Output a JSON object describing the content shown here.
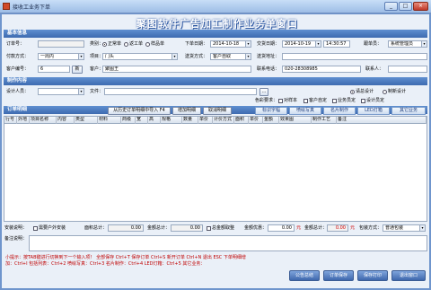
{
  "window": {
    "title": "接收工业务下单",
    "min": "_",
    "max": "□",
    "close": "×"
  },
  "heading": "聚图软件广告加工制作业务单窗口",
  "sections": {
    "basic": "基本信息",
    "design": "制作内容",
    "detail": "订单明细"
  },
  "basic": {
    "order_no_label": "订单号：",
    "category_label": "类别：",
    "category_options": [
      "正常单",
      "返工单",
      "样品单"
    ],
    "order_date_label": "下单日期：",
    "order_date": "2014-10-18",
    "delivery_date_label": "交货日期：",
    "delivery_date": "2014-10-19",
    "delivery_time": "14:30:57",
    "follower_label": "跟单员：",
    "follower": "系统管理员",
    "payment_label": "付款方式：",
    "payment": "一周内",
    "project_label": "项目：",
    "project": "门头",
    "ship_method_label": "送货方式：",
    "ship_method": "客户自取",
    "ship_addr_label": "送货地址：",
    "customer_no_label": "客户编号：",
    "customer_no": "6",
    "new_label": "新",
    "customer_label": "客户：",
    "customer": "聚图王",
    "phone_label": "联系电话：",
    "phone": "020-28308985",
    "contact_label": "联系人："
  },
  "design": {
    "designer_label": "设计人员：",
    "file_label": "文件：",
    "color_req_label": "色彩要求：",
    "checks": [
      "对样本",
      "客户自定",
      "业务员定",
      "设计员定"
    ],
    "design_radio": [
      "请总设计",
      "制新设计"
    ]
  },
  "detail": {
    "import_label": "从历史订单明细中导入 F4",
    "add_label": "增加明细",
    "cancel_label": "取消明细",
    "tabs": [
      "标识字幅",
      "喷绘写真",
      "名片制作",
      "LED灯箱",
      "其它业务"
    ],
    "columns": [
      "行号",
      "外地",
      "项目名称",
      "内容",
      "类型",
      "材料",
      "商级",
      "宽",
      "高",
      "规格",
      "数量",
      "单价",
      "计价方式",
      "面积",
      "单价",
      "金额",
      "效果图",
      "制作工艺",
      "备注"
    ]
  },
  "footer": {
    "install_label": "安装说明：",
    "need_install_label": "需要户外安装",
    "area_total_label": "面积总计：",
    "area_total": "0.00",
    "amount_total_label": "金额总计：",
    "amount_total": "0.00",
    "discount_label": "总金额取整",
    "discount_amount_label": "金额优惠：",
    "discount_amount": "0.00",
    "discount_unit": "元",
    "total_amount_label": "金额总计：",
    "total_amount": "0.00",
    "total_unit": "元",
    "package_label": "包装方式：",
    "package": "普通包装",
    "remark_label": "备注说明："
  },
  "status": {
    "line1": "小提示：按TAB键进行切换到下一个输入项！ 全部保存 Ctrl+T 保存订单 Ctrl+S 新开订单 Ctrl+N 退出 ESC 下单明细增",
    "line2": "加：Ctrl+I 包括列表：Ctrl+2 喷绘写真：Ctrl+3 名片制作：Ctrl+4 LED灯箱：Ctrl+5 其它业务："
  },
  "actions": [
    "公告总结",
    "订单保存",
    "保存打印",
    "退出窗口"
  ],
  "colors": {
    "accent": "#3e6bb0",
    "heading": "#ffffff",
    "alert": "#d00000"
  }
}
